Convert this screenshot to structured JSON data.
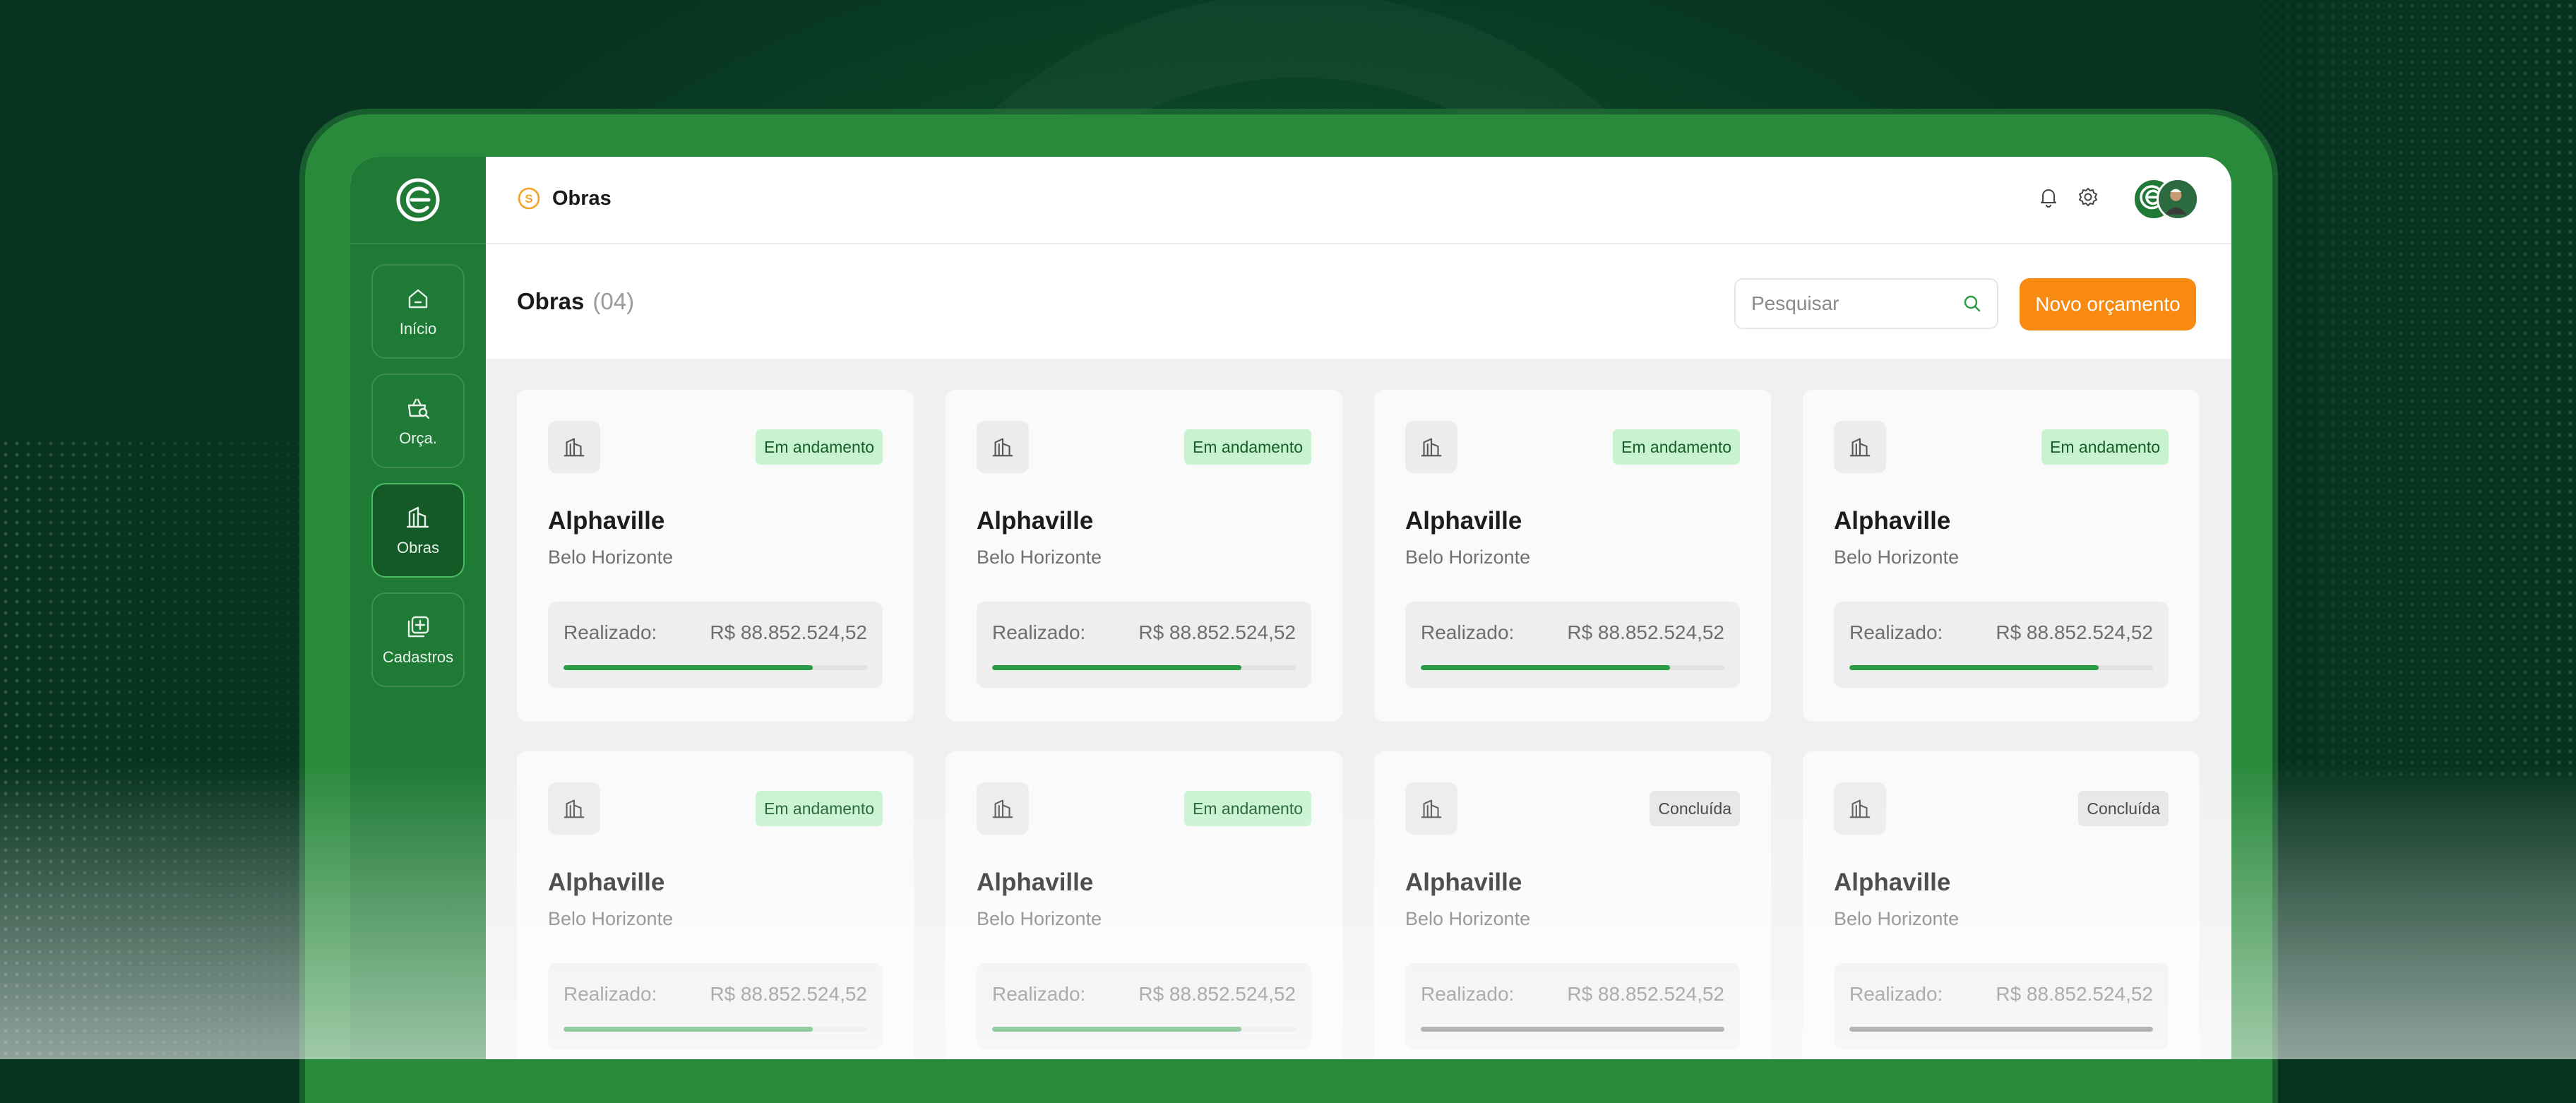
{
  "app": {
    "breadcrumb_title": "Obras"
  },
  "sidebar": {
    "items": [
      {
        "label": "Início",
        "icon": "home-icon",
        "active": false
      },
      {
        "label": "Orça.",
        "icon": "basket-search-icon",
        "active": false
      },
      {
        "label": "Obras",
        "icon": "building-icon",
        "active": true
      },
      {
        "label": "Cadastros",
        "icon": "add-square-icon",
        "active": false
      }
    ]
  },
  "header": {
    "title": "Obras",
    "count": "(04)",
    "search_placeholder": "Pesquisar",
    "new_button_label": "Novo orçamento"
  },
  "colors": {
    "brand_green": "#1f7a35",
    "accent_orange": "#f88a12",
    "progress_green": "#2a9a45",
    "progress_gray": "#6a6a6a",
    "badge_ongoing_bg": "#c7f3cf"
  },
  "cards": [
    {
      "name": "Alphaville",
      "city": "Belo Horizonte",
      "status": "Em andamento",
      "status_type": "ongoing",
      "label": "Realizado:",
      "value": "R$ 88.852.524,52",
      "progress": 0.82
    },
    {
      "name": "Alphaville",
      "city": "Belo Horizonte",
      "status": "Em andamento",
      "status_type": "ongoing",
      "label": "Realizado:",
      "value": "R$ 88.852.524,52",
      "progress": 0.82
    },
    {
      "name": "Alphaville",
      "city": "Belo Horizonte",
      "status": "Em andamento",
      "status_type": "ongoing",
      "label": "Realizado:",
      "value": "R$ 88.852.524,52",
      "progress": 0.82
    },
    {
      "name": "Alphaville",
      "city": "Belo Horizonte",
      "status": "Em andamento",
      "status_type": "ongoing",
      "label": "Realizado:",
      "value": "R$ 88.852.524,52",
      "progress": 0.82
    },
    {
      "name": "Alphaville",
      "city": "Belo Horizonte",
      "status": "Em andamento",
      "status_type": "ongoing",
      "label": "Realizado:",
      "value": "R$ 88.852.524,52",
      "progress": 0.82
    },
    {
      "name": "Alphaville",
      "city": "Belo Horizonte",
      "status": "Em andamento",
      "status_type": "ongoing",
      "label": "Realizado:",
      "value": "R$ 88.852.524,52",
      "progress": 0.82
    },
    {
      "name": "Alphaville",
      "city": "Belo Horizonte",
      "status": "Concluída",
      "status_type": "done",
      "label": "Realizado:",
      "value": "R$ 88.852.524,52",
      "progress": 1.0
    },
    {
      "name": "Alphaville",
      "city": "Belo Horizonte",
      "status": "Concluída",
      "status_type": "done",
      "label": "Realizado:",
      "value": "R$ 88.852.524,52",
      "progress": 1.0
    }
  ]
}
